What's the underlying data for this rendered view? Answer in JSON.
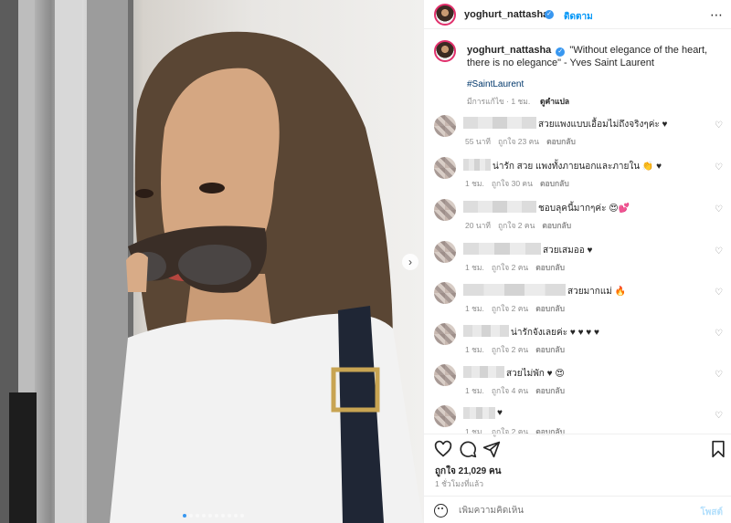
{
  "post": {
    "username": "yoghurt_nattasha",
    "follow_label": "ติดตาม",
    "more_label": "⋯",
    "caption": "\"Without elegance of the heart, there is no elegance\" - Yves Saint Laurent",
    "hashtag": "#SaintLaurent",
    "edited_label": "มีการแก้ไข · 1 ชม.",
    "translate_label": "ดูคำแปล",
    "likes_label": "ถูกใจ 21,029 คน",
    "time_label": "1 ชั่วโมงที่แล้ว",
    "add_comment_placeholder": "เพิ่มความคิดเห็น",
    "post_label": "โพสต์",
    "next_glyph": "›"
  },
  "comments": [
    {
      "text": "สวยแพงแบบเอื้อมไม่ถึงจริงๆค่ะ ♥",
      "age": "55 นาที",
      "likes": "ถูกใจ 23 คน",
      "reply": "ตอบกลับ"
    },
    {
      "text": "น่ารัก สวย แพงทั้งภายนอกและภายใน 👏 ♥",
      "age": "1 ชม.",
      "likes": "ถูกใจ 30 คน",
      "reply": "ตอบกลับ"
    },
    {
      "text": "ชอบลุคนี้มากๆค่ะ 😍💕",
      "age": "20 นาที",
      "likes": "ถูกใจ 2 คน",
      "reply": "ตอบกลับ"
    },
    {
      "text": "สวยเสมออ ♥",
      "age": "1 ชม.",
      "likes": "ถูกใจ 2 คน",
      "reply": "ตอบกลับ"
    },
    {
      "text": "สวยมากแม่ 🔥",
      "age": "1 ชม.",
      "likes": "ถูกใจ 2 คน",
      "reply": "ตอบกลับ"
    },
    {
      "text": "น่ารักจังเลยค่ะ ♥ ♥ ♥ ♥",
      "age": "1 ชม.",
      "likes": "ถูกใจ 2 คน",
      "reply": "ตอบกลับ"
    },
    {
      "text": "สวยไม่พัก ♥ 😍",
      "age": "1 ชม.",
      "likes": "ถูกใจ 4 คน",
      "reply": "ตอบกลับ"
    },
    {
      "text": "♥",
      "age": "1 ชม.",
      "likes": "ถูกใจ 2 คน",
      "reply": "ตอบกลับ"
    }
  ],
  "icons": {
    "like": "heart-outline-icon",
    "comment": "comment-bubble-icon",
    "share": "paper-plane-icon",
    "save": "bookmark-icon",
    "emoji": "emoji-smile-icon"
  },
  "carousel": {
    "slides": 10,
    "active": 0
  }
}
